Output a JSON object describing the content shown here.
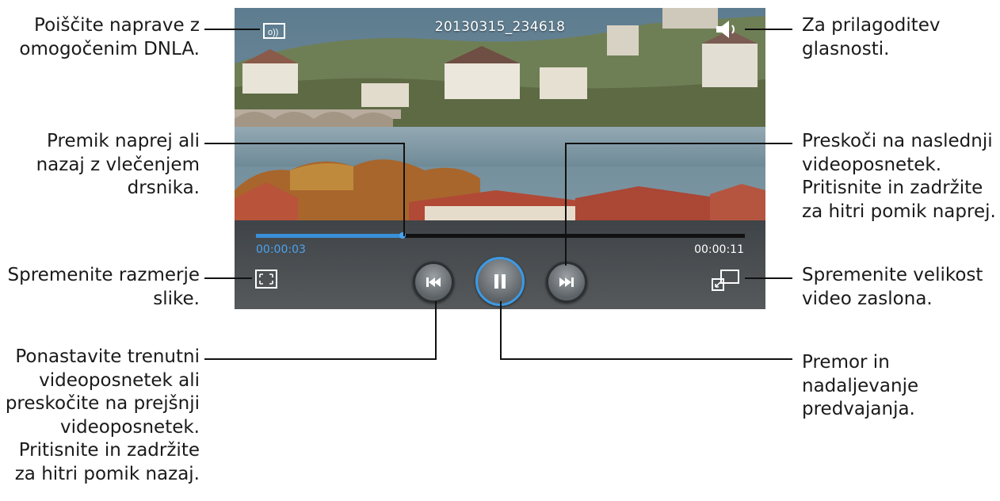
{
  "player": {
    "video_title": "20130315_234618",
    "time_elapsed": "00:00:03",
    "time_total": "00:00:11",
    "progress_fraction": 0.3,
    "accent_color": "#3a8fd8"
  },
  "icons": {
    "dlna": "dlna-screen-icon",
    "volume": "speaker-volume-icon",
    "aspect": "aspect-ratio-icon",
    "previous": "skip-previous-icon",
    "play_pause": "pause-icon",
    "next": "skip-next-icon",
    "popup": "popup-player-icon"
  },
  "callouts": {
    "dlna": "Poiščite naprave z\nomogočenim DNLA.",
    "seek": "Premik naprej ali\nnazaj z vlečenjem\ndrsnika.",
    "aspect": "Spremenite razmerje\nslike.",
    "previous": "Ponastavite trenutni\nvideoposnetek ali\npreskočite na prejšnji\nvideoposnetek.\nPritisnite in zadržite\nza hitri pomik nazaj.",
    "volume": "Za prilagoditev\nglasnosti.",
    "next": "Preskoči na naslednji\nvideoposnetek.\nPritisnite in zadržite\nza hitri pomik naprej.",
    "popup": "Spremenite velikost\nvideo zaslona.",
    "pause": "Premor in\nnadaljevanje\npredvajanja."
  }
}
